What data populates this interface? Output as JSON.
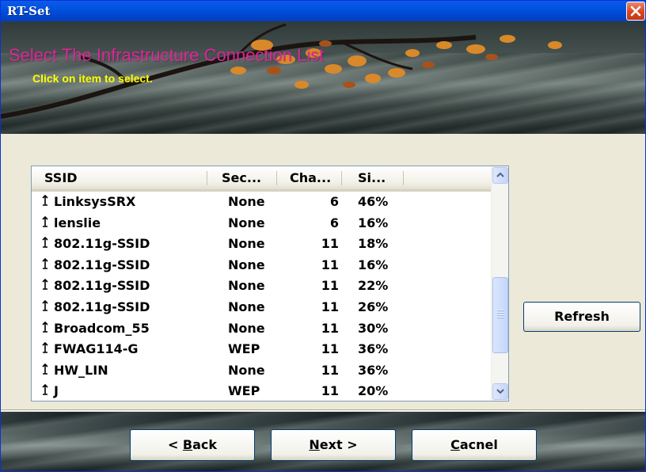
{
  "window": {
    "title": "RT-Set",
    "close_icon": "close-icon"
  },
  "banner": {
    "heading": "Select The Infrastructure Connection List",
    "subheading": "Click on item to select.",
    "heading_color": "#e0249a",
    "subheading_color": "#ffff00"
  },
  "list": {
    "columns": [
      "SSID",
      "Sec...",
      "Cha...",
      "Si..."
    ],
    "rows": [
      {
        "icon": "signal-icon",
        "ssid": "LinksysSRX",
        "security": "None",
        "channel": "6",
        "signal": "46%"
      },
      {
        "icon": "signal-icon",
        "ssid": "lenslie",
        "security": "None",
        "channel": "6",
        "signal": "16%"
      },
      {
        "icon": "signal-icon",
        "ssid": "802.11g-SSID",
        "security": "None",
        "channel": "11",
        "signal": "18%"
      },
      {
        "icon": "signal-icon",
        "ssid": "802.11g-SSID",
        "security": "None",
        "channel": "11",
        "signal": "16%"
      },
      {
        "icon": "signal-icon",
        "ssid": "802.11g-SSID",
        "security": "None",
        "channel": "11",
        "signal": "22%"
      },
      {
        "icon": "signal-icon",
        "ssid": "802.11g-SSID",
        "security": "None",
        "channel": "11",
        "signal": "26%"
      },
      {
        "icon": "signal-icon",
        "ssid": "Broadcom_55",
        "security": "None",
        "channel": "11",
        "signal": "30%"
      },
      {
        "icon": "signal-icon",
        "ssid": "FWAG114-G",
        "security": "WEP",
        "channel": "11",
        "signal": "36%"
      },
      {
        "icon": "signal-icon",
        "ssid": "HW_LIN",
        "security": "None",
        "channel": "11",
        "signal": "36%"
      },
      {
        "icon": "signal-icon",
        "ssid": "J",
        "security": "WEP",
        "channel": "11",
        "signal": "20%"
      }
    ]
  },
  "buttons": {
    "refresh": "Refresh",
    "back_prefix": "< ",
    "back_mnemonic": "B",
    "back_rest": "ack",
    "next_mnemonic": "N",
    "next_rest": "ext >",
    "cancel_mnemonic": "C",
    "cancel_rest": "acnel"
  }
}
